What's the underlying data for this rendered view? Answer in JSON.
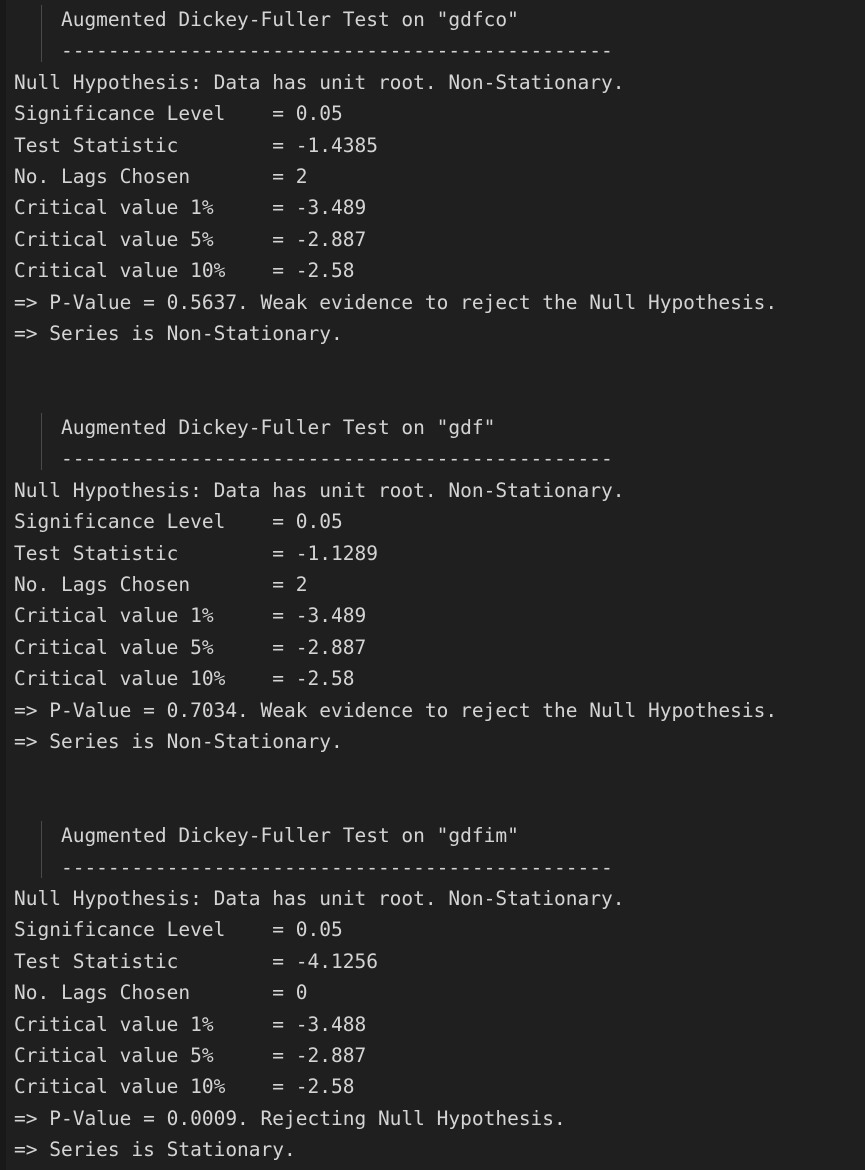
{
  "console": {
    "title": "Augmented Dickey-Fuller Test Output",
    "background_color": "#1f1f1f",
    "text_color": "#d4d4d4",
    "indent_guide_color": "#4a4a4a",
    "blocks": [
      {
        "id": "adf-gdfco",
        "header": "    Augmented Dickey-Fuller Test on \"gdfco\"",
        "separator": "    -----------------------------------------------",
        "series_name": "gdfco",
        "lines": [
          "Null Hypothesis: Data has unit root. Non-Stationary.",
          "Significance Level    = 0.05",
          "Test Statistic        = -1.4385",
          "No. Lags Chosen       = 2",
          "Critical value 1%     = -3.489",
          "Critical value 5%     = -2.887",
          "Critical value 10%    = -2.58",
          "=> P-Value = 0.5637. Weak evidence to reject the Null Hypothesis.",
          "=> Series is Non-Stationary."
        ],
        "values": {
          "null_hypothesis": "Data has unit root. Non-Stationary.",
          "significance_level": "0.05",
          "test_statistic": "-1.4385",
          "no_lags_chosen": "2",
          "critical_value_1pct": "-3.489",
          "critical_value_5pct": "-2.887",
          "critical_value_10pct": "-2.58",
          "p_value": "0.5637",
          "conclusion": "Weak evidence to reject the Null Hypothesis.",
          "verdict": "Series is Non-Stationary."
        }
      },
      {
        "id": "adf-gdf",
        "header": "    Augmented Dickey-Fuller Test on \"gdf\"",
        "separator": "    -----------------------------------------------",
        "series_name": "gdf",
        "lines": [
          "Null Hypothesis: Data has unit root. Non-Stationary.",
          "Significance Level    = 0.05",
          "Test Statistic        = -1.1289",
          "No. Lags Chosen       = 2",
          "Critical value 1%     = -3.489",
          "Critical value 5%     = -2.887",
          "Critical value 10%    = -2.58",
          "=> P-Value = 0.7034. Weak evidence to reject the Null Hypothesis.",
          "=> Series is Non-Stationary."
        ],
        "values": {
          "null_hypothesis": "Data has unit root. Non-Stationary.",
          "significance_level": "0.05",
          "test_statistic": "-1.1289",
          "no_lags_chosen": "2",
          "critical_value_1pct": "-3.489",
          "critical_value_5pct": "-2.887",
          "critical_value_10pct": "-2.58",
          "p_value": "0.7034",
          "conclusion": "Weak evidence to reject the Null Hypothesis.",
          "verdict": "Series is Non-Stationary."
        }
      },
      {
        "id": "adf-gdfim",
        "header": "    Augmented Dickey-Fuller Test on \"gdfim\"",
        "separator": "    -----------------------------------------------",
        "series_name": "gdfim",
        "lines": [
          "Null Hypothesis: Data has unit root. Non-Stationary.",
          "Significance Level    = 0.05",
          "Test Statistic        = -4.1256",
          "No. Lags Chosen       = 0",
          "Critical value 1%     = -3.488",
          "Critical value 5%     = -2.887",
          "Critical value 10%    = -2.58",
          "=> P-Value = 0.0009. Rejecting Null Hypothesis.",
          "=> Series is Stationary."
        ],
        "values": {
          "null_hypothesis": "Data has unit root. Non-Stationary.",
          "significance_level": "0.05",
          "test_statistic": "-4.1256",
          "no_lags_chosen": "0",
          "critical_value_1pct": "-3.488",
          "critical_value_5pct": "-2.887",
          "critical_value_10pct": "-2.58",
          "p_value": "0.0009",
          "conclusion": "Rejecting Null Hypothesis.",
          "verdict": "Series is Stationary."
        }
      }
    ]
  }
}
